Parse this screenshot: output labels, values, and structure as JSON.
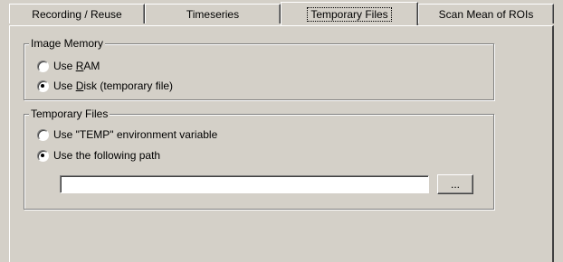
{
  "tabs": [
    {
      "label": "Recording / Reuse",
      "active": false
    },
    {
      "label": "Timeseries",
      "active": false
    },
    {
      "label": "Temporary Files",
      "active": true
    },
    {
      "label": "Scan Mean of ROIs",
      "active": false
    }
  ],
  "image_memory": {
    "legend": "Image Memory",
    "options": [
      {
        "pre": "Use ",
        "key": "R",
        "post": "AM",
        "checked": false
      },
      {
        "pre": "Use ",
        "key": "D",
        "post": "isk (temporary file)",
        "checked": true
      }
    ]
  },
  "temporary_files": {
    "legend": "Temporary Files",
    "options": [
      {
        "label": "Use \"TEMP\" environment variable",
        "checked": false
      },
      {
        "label": "Use the following path",
        "checked": true
      }
    ],
    "path_value": "",
    "browse_label": "..."
  }
}
